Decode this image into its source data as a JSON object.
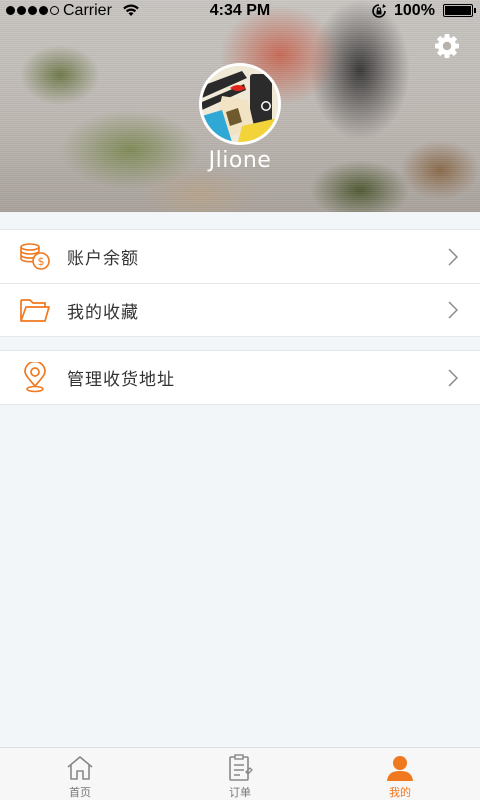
{
  "status_bar": {
    "carrier": "Carrier",
    "time": "4:34 PM",
    "battery": "100%"
  },
  "profile": {
    "username": "Jlione",
    "settings_icon": "gear-icon"
  },
  "menu": {
    "group1": [
      {
        "label": "账户余额",
        "icon": "coins-icon"
      },
      {
        "label": "我的收藏",
        "icon": "folder-icon"
      }
    ],
    "group2": [
      {
        "label": "管理收货地址",
        "icon": "location-pin-icon"
      }
    ]
  },
  "tabs": [
    {
      "label": "首页",
      "icon": "home-icon",
      "active": false
    },
    {
      "label": "订单",
      "icon": "order-list-icon",
      "active": false
    },
    {
      "label": "我的",
      "icon": "user-icon",
      "active": true
    }
  ],
  "colors": {
    "accent": "#f0781e",
    "background": "#f3f6f9",
    "text": "#333333"
  }
}
